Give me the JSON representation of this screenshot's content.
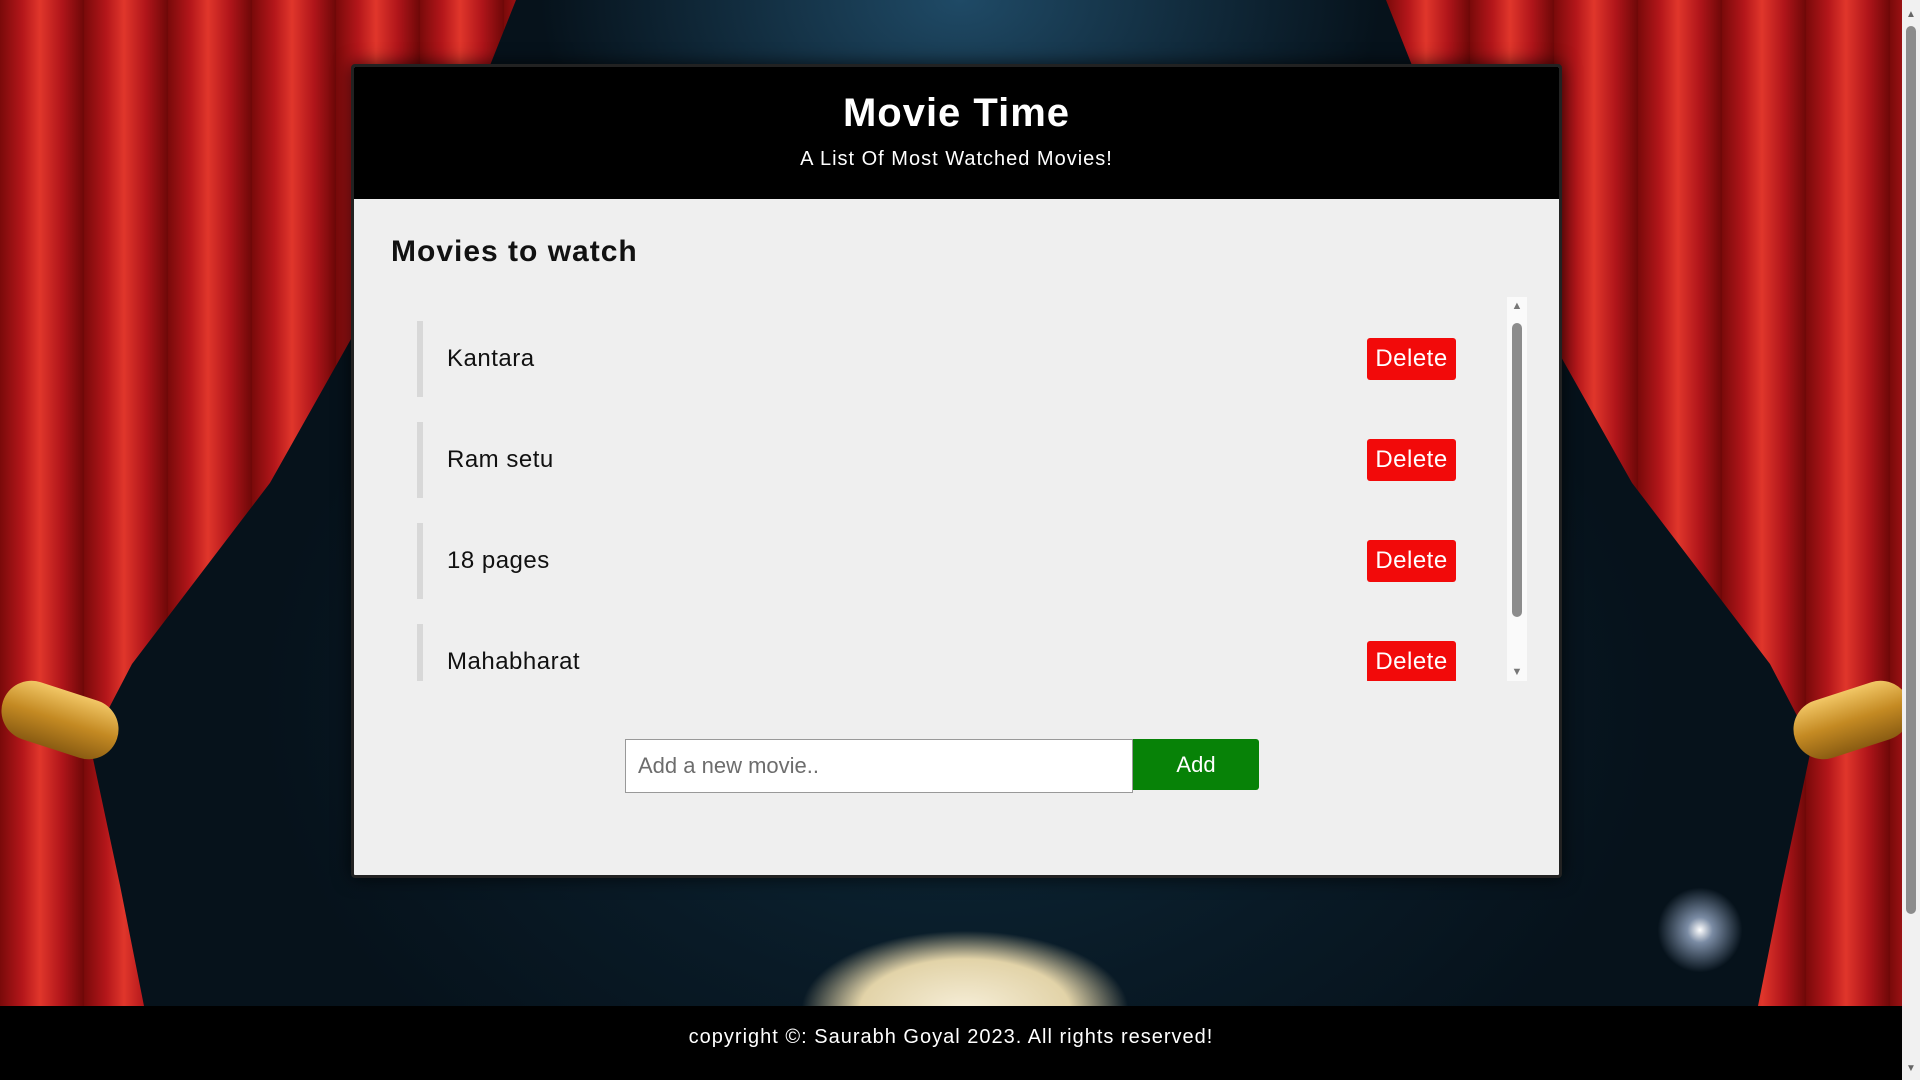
{
  "header": {
    "title": "Movie Time",
    "subtitle": "A List Of Most Watched Movies!"
  },
  "list": {
    "title": "Movies to watch",
    "items": [
      {
        "name": "Kantara",
        "delete_label": "Delete"
      },
      {
        "name": "Ram setu",
        "delete_label": "Delete"
      },
      {
        "name": "18 pages",
        "delete_label": "Delete"
      },
      {
        "name": "Mahabharat",
        "delete_label": "Delete"
      }
    ]
  },
  "form": {
    "placeholder": "Add a new movie..",
    "value": "",
    "add_label": "Add"
  },
  "footer": {
    "text": "copyright ©: Saurabh Goyal 2023. All rights reserved!"
  },
  "colors": {
    "delete": "#f20a0a",
    "add": "#078207",
    "header_bg": "#000000",
    "card_bg": "#efefef"
  }
}
